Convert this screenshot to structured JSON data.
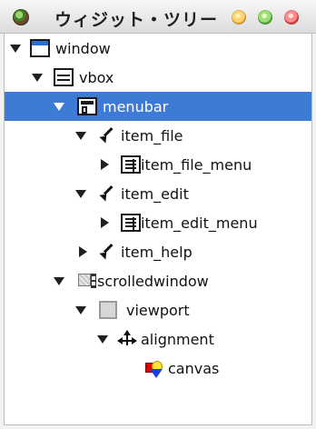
{
  "window": {
    "title": "ウィジット・ツリー"
  },
  "tree": {
    "nodes": [
      {
        "label": "window",
        "icon": "window-icon",
        "expander": "down",
        "selected": false
      },
      {
        "label": "vbox",
        "icon": "vbox-icon",
        "expander": "down",
        "selected": false
      },
      {
        "label": "menubar",
        "icon": "menubar-icon",
        "expander": "down",
        "selected": true
      },
      {
        "label": "item_file",
        "icon": "menu-item-icon",
        "expander": "down",
        "selected": false
      },
      {
        "label": "item_file_menu",
        "icon": "menu-icon",
        "expander": "right",
        "selected": false
      },
      {
        "label": "item_edit",
        "icon": "menu-item-icon",
        "expander": "down",
        "selected": false
      },
      {
        "label": "item_edit_menu",
        "icon": "menu-icon",
        "expander": "right",
        "selected": false
      },
      {
        "label": "item_help",
        "icon": "menu-item-icon",
        "expander": "right",
        "selected": false
      },
      {
        "label": "scrolledwindow",
        "icon": "scrolled-window-icon",
        "expander": "down",
        "selected": false
      },
      {
        "label": "viewport",
        "icon": "viewport-icon",
        "expander": "down",
        "selected": false
      },
      {
        "label": "alignment",
        "icon": "alignment-icon",
        "expander": "down",
        "selected": false
      },
      {
        "label": "canvas",
        "icon": "canvas-icon",
        "expander": "none",
        "selected": false
      }
    ]
  },
  "colors": {
    "selection": "#3e7bd7",
    "text": "#111111"
  }
}
